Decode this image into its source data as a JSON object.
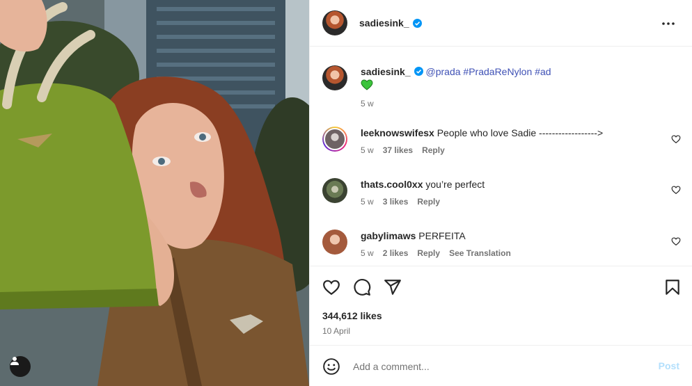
{
  "post": {
    "username": "sadiesink_",
    "likes": "344,612 likes",
    "date": "10 April"
  },
  "caption": {
    "username": "sadiesink_",
    "mention": "@prada",
    "hashtag1": "#PradaReNylon",
    "hashtag2": "#ad",
    "emoji": "💚",
    "time": "5 w"
  },
  "comments": [
    {
      "username": "leeknowswifesx",
      "text": "People who love Sadie ------------------>",
      "time": "5 w",
      "likes": "37 likes",
      "reply": "Reply"
    },
    {
      "username": "thats.cool0xx",
      "text": "you’re perfect",
      "time": "5 w",
      "likes": "3 likes",
      "reply": "Reply"
    },
    {
      "username": "gabylimaws",
      "text": "PERFEITA",
      "time": "5 w",
      "likes": "2 likes",
      "reply": "Reply",
      "translate": "See Translation"
    }
  ],
  "composer": {
    "placeholder": "Add a comment...",
    "post_label": "Post"
  },
  "colors": {
    "link": "#3f51b5",
    "verified": "#0095f6",
    "post_disabled": "#b2dffc"
  },
  "icons": [
    "more-icon",
    "heart-icon",
    "comment-icon",
    "share-icon",
    "bookmark-icon",
    "emoji-icon",
    "user-tag-icon",
    "verified-icon"
  ]
}
